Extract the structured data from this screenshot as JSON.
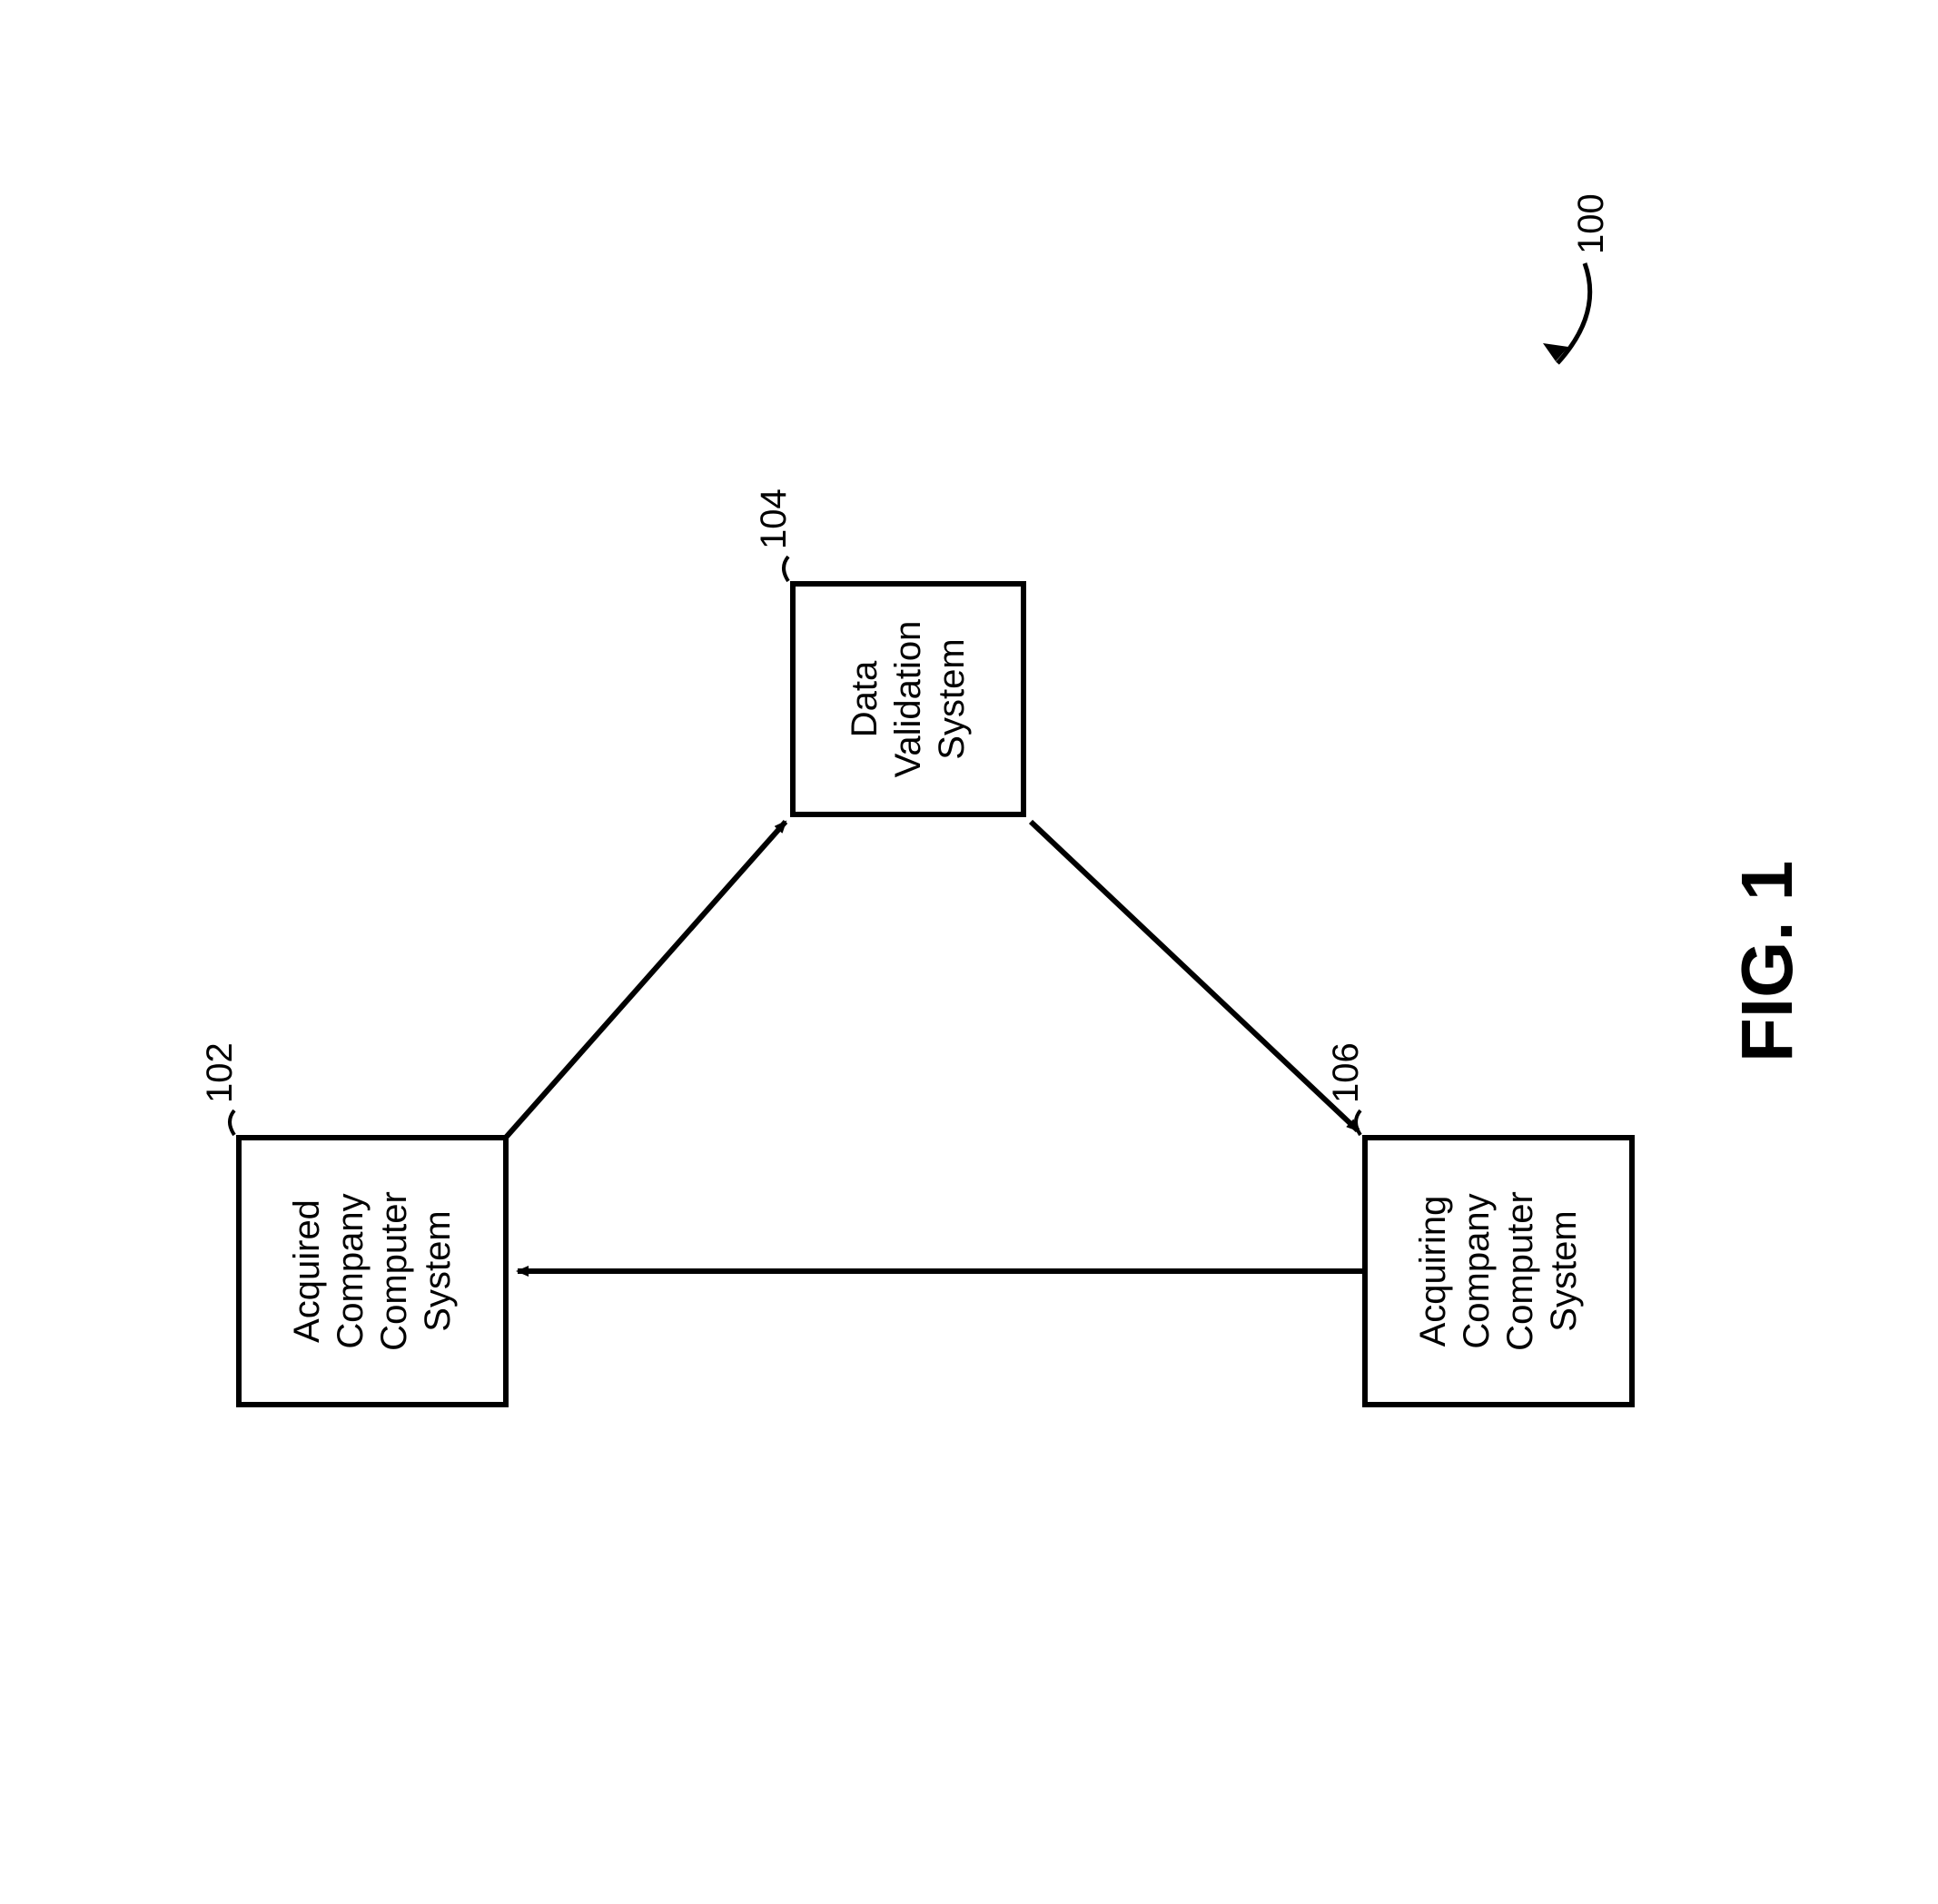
{
  "figure": {
    "title": "FIG. 1",
    "overall_ref": "100"
  },
  "nodes": {
    "acquired": {
      "ref": "102",
      "label": "Acquired Company Computer System"
    },
    "validation": {
      "ref": "104",
      "label": "Data Validation System"
    },
    "acquiring": {
      "ref": "106",
      "label": "Acquiring Company Computer System"
    }
  }
}
